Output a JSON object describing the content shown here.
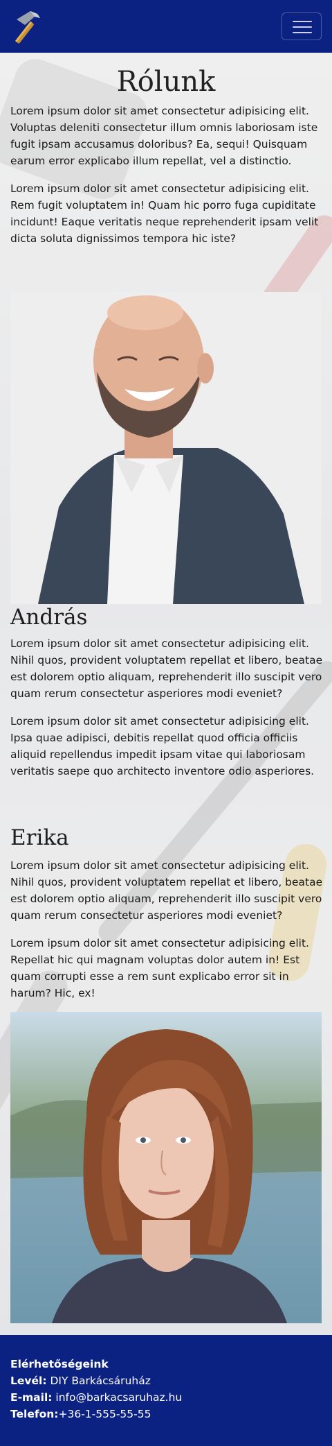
{
  "nav": {
    "logo": "hammer-logo",
    "toggler": "menu-icon"
  },
  "about": {
    "title": "Rólunk",
    "p1": "Lorem ipsum dolor sit amet consectetur adipisicing elit. Voluptas deleniti consectetur illum omnis laboriosam iste fugit ipsam accusamus doloribus? Ea, sequi! Quisquam earum error explicabo illum repellat, vel a distinctio.",
    "p2": "Lorem ipsum dolor sit amet consectetur adipisicing elit. Rem fugit voluptatem in! Quam hic porro fuga cupiditate incidunt! Eaque veritatis neque reprehenderit ipsam velit dicta soluta dignissimos tempora hic iste?"
  },
  "andras": {
    "name": "András",
    "p1": "Lorem ipsum dolor sit amet consectetur adipisicing elit. Nihil quos, provident voluptatem repellat et libero, beatae est dolorem optio aliquam, reprehenderit illo suscipit vero quam rerum consectetur asperiores modi eveniet?",
    "p2": "Lorem ipsum dolor sit amet consectetur adipisicing elit. Ipsa quae adipisci, debitis repellat quod officia officiis aliquid repellendus impedit ipsam vitae qui laboriosam veritatis saepe quo architecto inventore odio asperiores."
  },
  "erika": {
    "name": "Erika",
    "p1": "Lorem ipsum dolor sit amet consectetur adipisicing elit. Nihil quos, provident voluptatem repellat et libero, beatae est dolorem optio aliquam, reprehenderit illo suscipit vero quam rerum consectetur asperiores modi eveniet?",
    "p2": "Lorem ipsum dolor sit amet consectetur adipisicing elit. Repellat hic qui magnam voluptas dolor autem in! Est quam corrupti esse a rem sunt explicabo error sit in harum? Hic, ex!"
  },
  "footer": {
    "title": "Elérhetőségeink",
    "mail_label": "Levél:",
    "mail_value": "DIY Barkácsáruház",
    "email_label": "E-mail:",
    "email_value": "info@barkacsaruhaz.hu",
    "phone_label": "Telefon:",
    "phone_value": "+36-1-555-55-55"
  },
  "colors": {
    "brand": "#0b2283",
    "text": "#1a1a1a"
  }
}
